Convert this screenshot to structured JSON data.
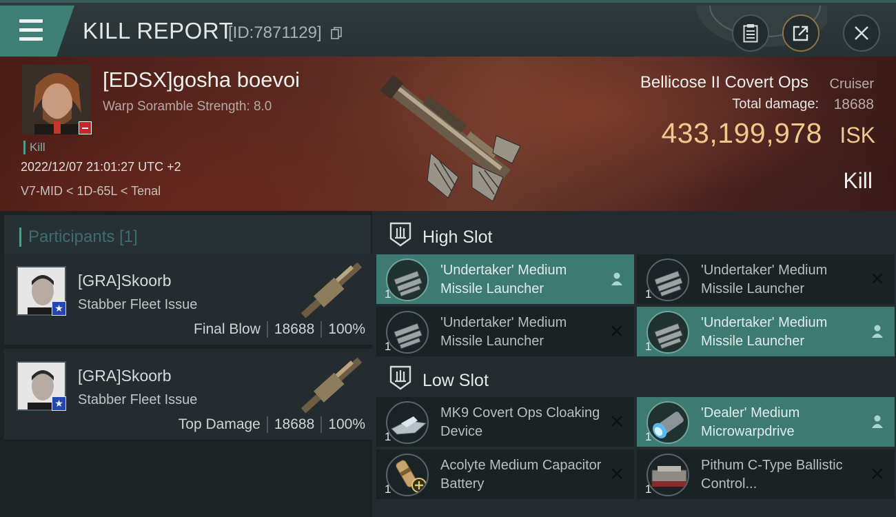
{
  "header": {
    "title": "KILL REPORT",
    "report_id": "[ID:7871129]"
  },
  "victim": {
    "name": "[EDSX]gosha boevoi",
    "subtitle": "Warp Soramble Strength: 8.0",
    "tag": "Kill",
    "datetime": "2022/12/07 21:01:27 UTC +2",
    "location": "V7-MID < 1D-65L < Tenal",
    "ship_name": "Bellicose II Covert Ops",
    "ship_class": "Cruiser",
    "damage_label": "Total damage:",
    "damage_value": "18688",
    "isk_value": "433,199,978",
    "isk_unit": "ISK",
    "result": "Kill"
  },
  "participants": {
    "title": "Participants [1]",
    "list": [
      {
        "name": "[GRA]Skoorb",
        "ship": "Stabber Fleet Issue",
        "role": "Final Blow",
        "damage": "18688",
        "percent": "100%"
      },
      {
        "name": "[GRA]Skoorb",
        "ship": "Stabber Fleet Issue",
        "role": "Top Damage",
        "damage": "18688",
        "percent": "100%"
      }
    ]
  },
  "fitting": {
    "high_slot": {
      "title": "High Slot",
      "modules": [
        {
          "name": "'Undertaker' Medium Missile Launcher",
          "qty": "1",
          "status": "pilot"
        },
        {
          "name": "'Undertaker' Medium Missile Launcher",
          "qty": "1",
          "status": "destroyed"
        },
        {
          "name": "'Undertaker' Medium Missile Launcher",
          "qty": "1",
          "status": "destroyed"
        },
        {
          "name": "'Undertaker' Medium Missile Launcher",
          "qty": "1",
          "status": "pilot"
        }
      ]
    },
    "low_slot": {
      "title": "Low Slot",
      "modules": [
        {
          "name": "MK9 Covert Ops Cloaking Device",
          "qty": "1",
          "status": "destroyed"
        },
        {
          "name": "'Dealer' Medium Microwarpdrive",
          "qty": "1",
          "status": "pilot"
        },
        {
          "name": "Acolyte Medium Capacitor Battery",
          "qty": "1",
          "status": "destroyed"
        },
        {
          "name": "Pithum C-Type Ballistic Control...",
          "qty": "1",
          "status": "destroyed"
        }
      ]
    }
  },
  "colors": {
    "accent": "#3d7a72",
    "isk": "#f1c98e",
    "badge": "#c4262b"
  }
}
